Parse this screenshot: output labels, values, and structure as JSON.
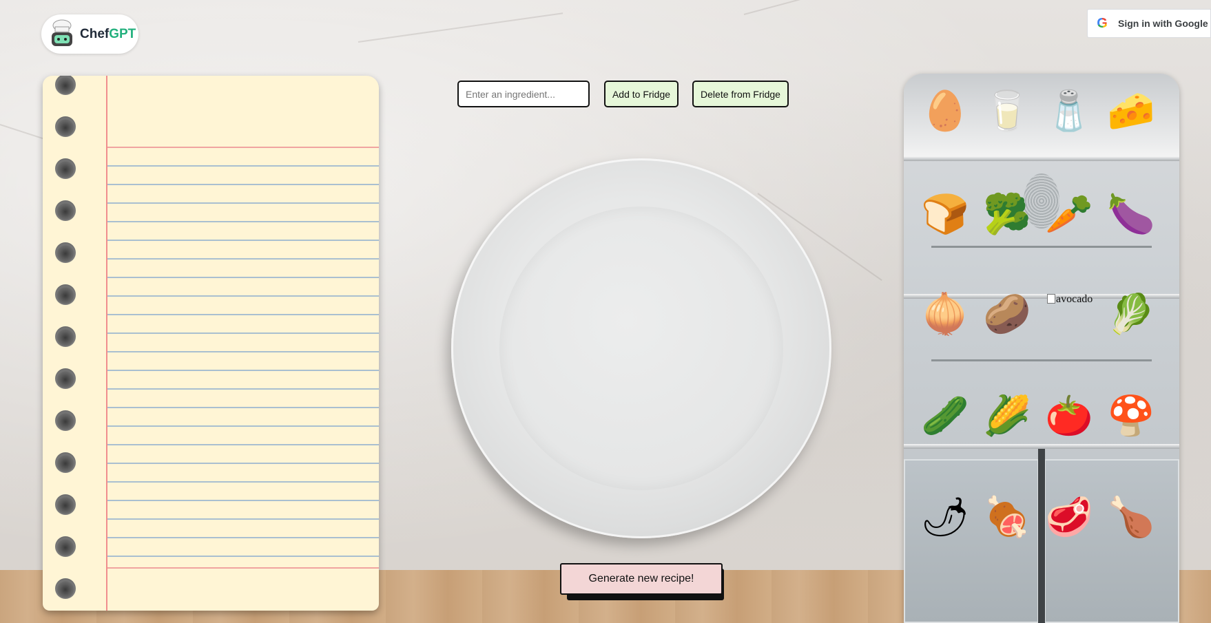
{
  "app": {
    "brand_prefix": "Chef",
    "brand_suffix": "GPT"
  },
  "auth": {
    "google_mark": "G",
    "sign_in_label": "Sign in with Google"
  },
  "ingredient_form": {
    "input_value": "",
    "input_placeholder": "Enter an ingredient...",
    "add_label": "Add to Fridge",
    "delete_label": "Delete from Fridge"
  },
  "generate": {
    "label": "Generate new recipe!"
  },
  "notebook": {
    "content": ""
  },
  "fridge": {
    "items": [
      {
        "name": "eggs",
        "glyph": "🥚"
      },
      {
        "name": "milk",
        "glyph": "🥛"
      },
      {
        "name": "salt",
        "glyph": "🧂"
      },
      {
        "name": "cheese",
        "glyph": "🧀"
      },
      {
        "name": "bread",
        "glyph": "🍞"
      },
      {
        "name": "broccoli",
        "glyph": "🥦"
      },
      {
        "name": "carrot",
        "glyph": "🥕"
      },
      {
        "name": "eggplant",
        "glyph": "🍆"
      },
      {
        "name": "onion",
        "glyph": "🧅"
      },
      {
        "name": "potato",
        "glyph": "🥔"
      },
      {
        "name": "avocado",
        "glyph": "avocado",
        "broken": true
      },
      {
        "name": "lettuce",
        "glyph": "🥬"
      },
      {
        "name": "cucumber",
        "glyph": "🥒"
      },
      {
        "name": "corn",
        "glyph": "🌽"
      },
      {
        "name": "tomato",
        "glyph": "🍅"
      },
      {
        "name": "mushroom",
        "glyph": "🍄"
      },
      {
        "name": "pepper",
        "glyph": "🌶"
      },
      {
        "name": "ham",
        "glyph": "🍖"
      },
      {
        "name": "steak",
        "glyph": "🥩"
      },
      {
        "name": "chicken",
        "glyph": "🍗"
      }
    ]
  }
}
